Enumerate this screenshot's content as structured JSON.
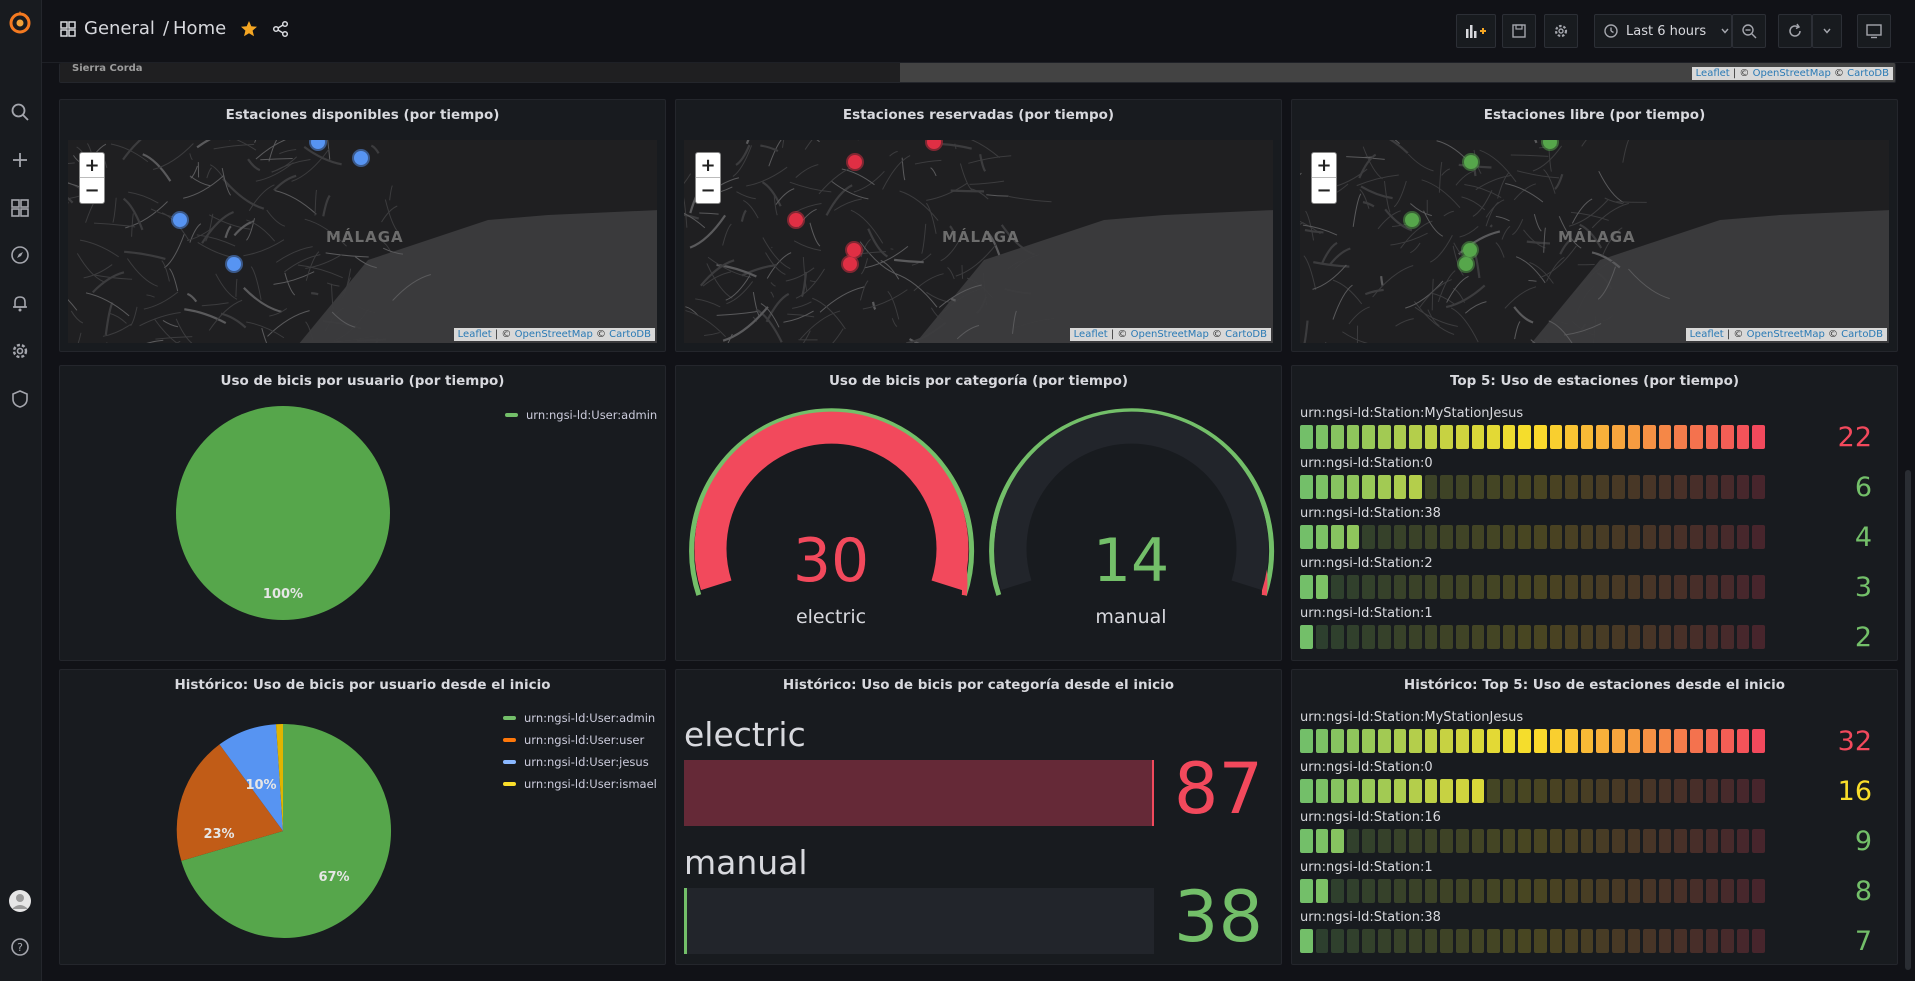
{
  "breadcrumb": {
    "folder": "General",
    "separator": "/",
    "dashboard": "Home"
  },
  "toolbar": {
    "time_range": "Last 6 hours"
  },
  "top_panel": {
    "map_label": "Sierra Corda",
    "attribution": {
      "leaflet": "Leaflet",
      "sep1": " | © ",
      "osm": "OpenStreetMap",
      "sep2": " © ",
      "carto": "CartoDB"
    }
  },
  "maps": {
    "available": {
      "title": "Estaciones disponibles (por tiempo)",
      "city": "MÁLAGA",
      "marker_color": "#5794f2"
    },
    "reserved": {
      "title": "Estaciones reservadas (por tiempo)",
      "city": "MÁLAGA",
      "marker_color": "#e02f44"
    },
    "free": {
      "title": "Estaciones libre (por tiempo)",
      "city": "MÁLAGA",
      "marker_color": "#56a64b"
    },
    "zoom_in": "+",
    "zoom_out": "−",
    "attr_leaflet": "Leaflet",
    "attr_sep1": " | © ",
    "attr_osm": "OpenStreetMap",
    "attr_sep2": " © ",
    "attr_carto": "CartoDB"
  },
  "usage_by_user": {
    "title": "Uso de bicis por usuario (por tiempo)",
    "legend": [
      {
        "label": "urn:ngsi-ld:User:admin",
        "color": "#73bf69"
      }
    ],
    "slice_label": "100%"
  },
  "usage_by_category": {
    "title": "Uso de bicis por categoría (por tiempo)",
    "gauges": [
      {
        "label": "electric",
        "value": "30",
        "color": "#f2495c"
      },
      {
        "label": "manual",
        "value": "14",
        "color": "#73bf69"
      }
    ]
  },
  "top5_time": {
    "title": "Top 5: Uso de estaciones (por tiempo)",
    "rows": [
      {
        "label": "urn:ngsi-ld:Station:MyStationJesus",
        "value": "22",
        "lit": 30,
        "color": "#f2495c"
      },
      {
        "label": "urn:ngsi-ld:Station:0",
        "value": "6",
        "lit": 8,
        "color": "#73bf69"
      },
      {
        "label": "urn:ngsi-ld:Station:38",
        "value": "4",
        "lit": 4,
        "color": "#73bf69"
      },
      {
        "label": "urn:ngsi-ld:Station:2",
        "value": "3",
        "lit": 2,
        "color": "#73bf69"
      },
      {
        "label": "urn:ngsi-ld:Station:1",
        "value": "2",
        "lit": 1,
        "color": "#73bf69"
      }
    ]
  },
  "hist_user": {
    "title": "Histórico: Uso de bicis por usuario desde el inicio",
    "legend": [
      {
        "label": "urn:ngsi-ld:User:admin",
        "color": "#73bf69"
      },
      {
        "label": "urn:ngsi-ld:User:user",
        "color": "#ff780a"
      },
      {
        "label": "urn:ngsi-ld:User:jesus",
        "color": "#8ab8ff"
      },
      {
        "label": "urn:ngsi-ld:User:ismael",
        "color": "#fade2a"
      }
    ],
    "slices": {
      "admin": "67%",
      "user": "23%",
      "jesus": "10%"
    }
  },
  "hist_category": {
    "title": "Histórico: Uso de bicis por categoría desde el inicio",
    "bars": [
      {
        "label": "electric",
        "value": "87",
        "color": "#f2495c"
      },
      {
        "label": "manual",
        "value": "38",
        "color": "#73bf69"
      }
    ]
  },
  "hist_top5": {
    "title": "Histórico: Top 5: Uso de estaciones desde el inicio",
    "rows": [
      {
        "label": "urn:ngsi-ld:Station:MyStationJesus",
        "value": "32",
        "lit": 30,
        "color": "#f2495c"
      },
      {
        "label": "urn:ngsi-ld:Station:0",
        "value": "16",
        "lit": 12,
        "color": "#fade2a"
      },
      {
        "label": "urn:ngsi-ld:Station:16",
        "value": "9",
        "lit": 3,
        "color": "#73bf69"
      },
      {
        "label": "urn:ngsi-ld:Station:1",
        "value": "8",
        "lit": 2,
        "color": "#73bf69"
      },
      {
        "label": "urn:ngsi-ld:Station:38",
        "value": "7",
        "lit": 1,
        "color": "#73bf69"
      }
    ]
  }
}
